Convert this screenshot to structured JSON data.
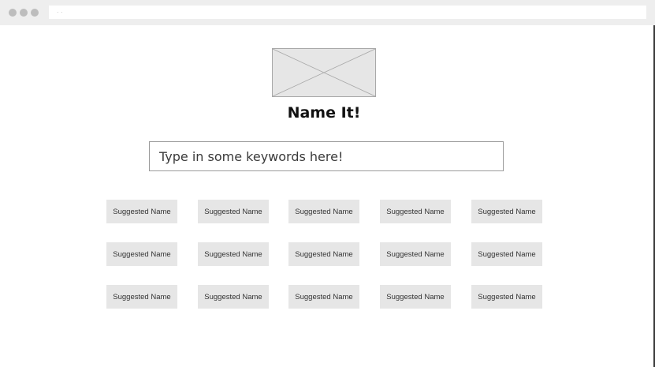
{
  "browser": {
    "url": ". ."
  },
  "logo": {
    "icon": "image-placeholder-icon"
  },
  "header": {
    "title": "Name It!"
  },
  "search": {
    "placeholder": "Type in some keywords here!",
    "value": ""
  },
  "suggestions": [
    [
      "Suggested Name",
      "Suggested Name",
      "Suggested Name",
      "Suggested Name",
      "Suggested Name"
    ],
    [
      "Suggested Name",
      "Suggested Name",
      "Suggested Name",
      "Suggested Name",
      "Suggested Name"
    ],
    [
      "Suggested Name",
      "Suggested Name",
      "Suggested Name",
      "Suggested Name",
      "Suggested Name"
    ]
  ],
  "colors": {
    "chrome": "#eeeeee",
    "chip_bg": "#e6e6e6",
    "placeholder_bg": "#e6e6e6"
  }
}
